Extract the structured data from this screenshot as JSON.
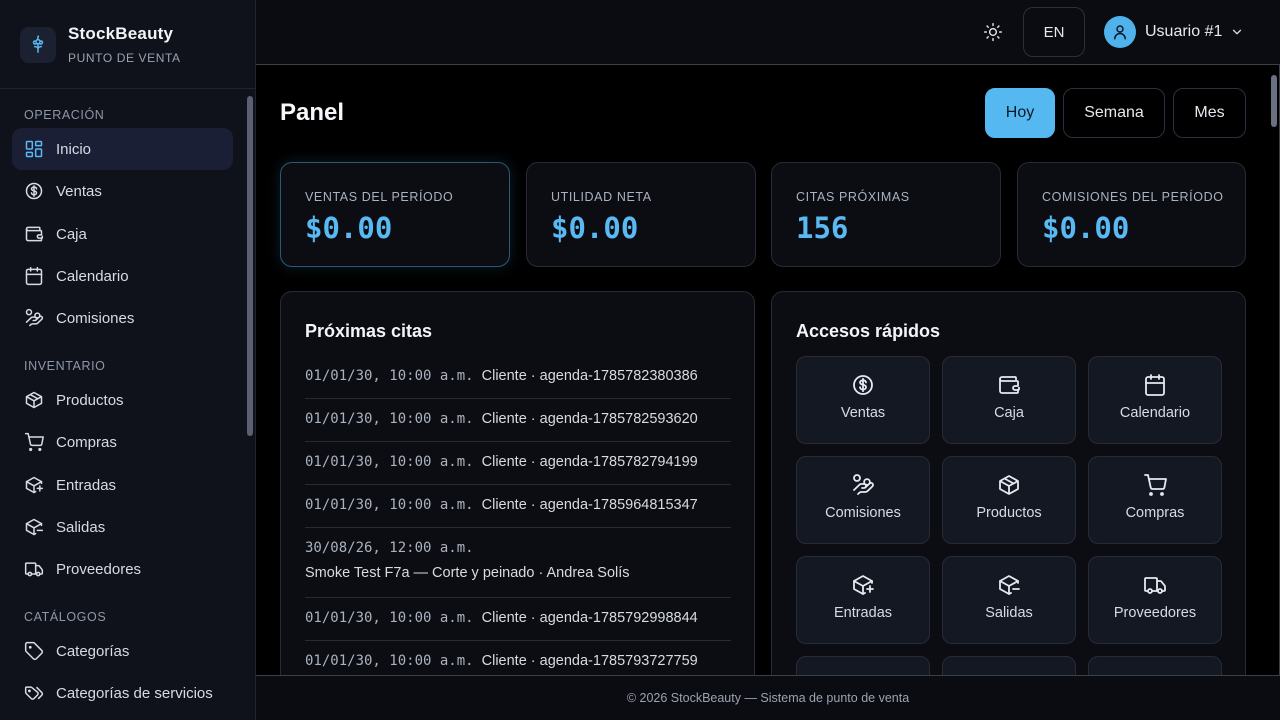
{
  "brand": {
    "name": "StockBeauty",
    "subtitle": "PUNTO DE VENTA",
    "icon": "flower-icon"
  },
  "sidebar": {
    "sections": [
      {
        "label": "OPERACIÓN",
        "items": [
          {
            "label": "Inicio",
            "icon": "dashboard-icon",
            "active": true
          },
          {
            "label": "Ventas",
            "icon": "dollar-icon"
          },
          {
            "label": "Caja",
            "icon": "wallet-icon"
          },
          {
            "label": "Calendario",
            "icon": "calendar-icon"
          },
          {
            "label": "Comisiones",
            "icon": "hand-coins-icon"
          }
        ]
      },
      {
        "label": "INVENTARIO",
        "items": [
          {
            "label": "Productos",
            "icon": "package-icon"
          },
          {
            "label": "Compras",
            "icon": "cart-icon"
          },
          {
            "label": "Entradas",
            "icon": "package-plus-icon"
          },
          {
            "label": "Salidas",
            "icon": "package-minus-icon"
          },
          {
            "label": "Proveedores",
            "icon": "truck-icon"
          }
        ]
      },
      {
        "label": "CATÁLOGOS",
        "items": [
          {
            "label": "Categorías",
            "icon": "tag-icon"
          },
          {
            "label": "Categorías de servicios",
            "icon": "tags-icon"
          }
        ]
      }
    ]
  },
  "topbar": {
    "language": "EN",
    "user": "Usuario #1",
    "theme_icon": "sun-icon"
  },
  "page": {
    "title": "Panel",
    "ranges": [
      {
        "label": "Hoy",
        "active": true
      },
      {
        "label": "Semana"
      },
      {
        "label": "Mes"
      }
    ]
  },
  "stats": [
    {
      "label": "VENTAS DEL PERÍODO",
      "value": "$0.00"
    },
    {
      "label": "UTILIDAD NETA",
      "value": "$0.00"
    },
    {
      "label": "CITAS PRÓXIMAS",
      "value": "156"
    },
    {
      "label": "COMISIONES DEL PERÍODO",
      "value": "$0.00"
    }
  ],
  "appointments": {
    "title": "Próximas citas",
    "items": [
      {
        "when": "01/01/30, 10:00 a.m.",
        "who": "Cliente · agenda-1785782380386"
      },
      {
        "when": "01/01/30, 10:00 a.m.",
        "who": "Cliente · agenda-1785782593620"
      },
      {
        "when": "01/01/30, 10:00 a.m.",
        "who": "Cliente · agenda-1785782794199"
      },
      {
        "when": "01/01/30, 10:00 a.m.",
        "who": "Cliente · agenda-1785964815347"
      },
      {
        "when": "30/08/26, 12:00 a.m.",
        "who": "Smoke Test F7a — Corte y peinado · Andrea Solís"
      },
      {
        "when": "01/01/30, 10:00 a.m.",
        "who": "Cliente · agenda-1785792998844"
      },
      {
        "when": "01/01/30, 10:00 a.m.",
        "who": "Cliente · agenda-1785793727759"
      }
    ]
  },
  "quick_access": {
    "title": "Accesos rápidos",
    "items": [
      {
        "label": "Ventas",
        "icon": "dollar-icon"
      },
      {
        "label": "Caja",
        "icon": "wallet-icon"
      },
      {
        "label": "Calendario",
        "icon": "calendar-icon"
      },
      {
        "label": "Comisiones",
        "icon": "hand-coins-icon"
      },
      {
        "label": "Productos",
        "icon": "package-icon"
      },
      {
        "label": "Compras",
        "icon": "cart-icon"
      },
      {
        "label": "Entradas",
        "icon": "package-plus-icon"
      },
      {
        "label": "Salidas",
        "icon": "package-minus-icon"
      },
      {
        "label": "Proveedores",
        "icon": "truck-icon"
      }
    ]
  },
  "footer": "© 2026 StockBeauty — Sistema de punto de venta",
  "colors": {
    "accent": "#56b8f0",
    "background": "#000000",
    "sidebar": "#0f121a",
    "card": "#0b0d12"
  }
}
